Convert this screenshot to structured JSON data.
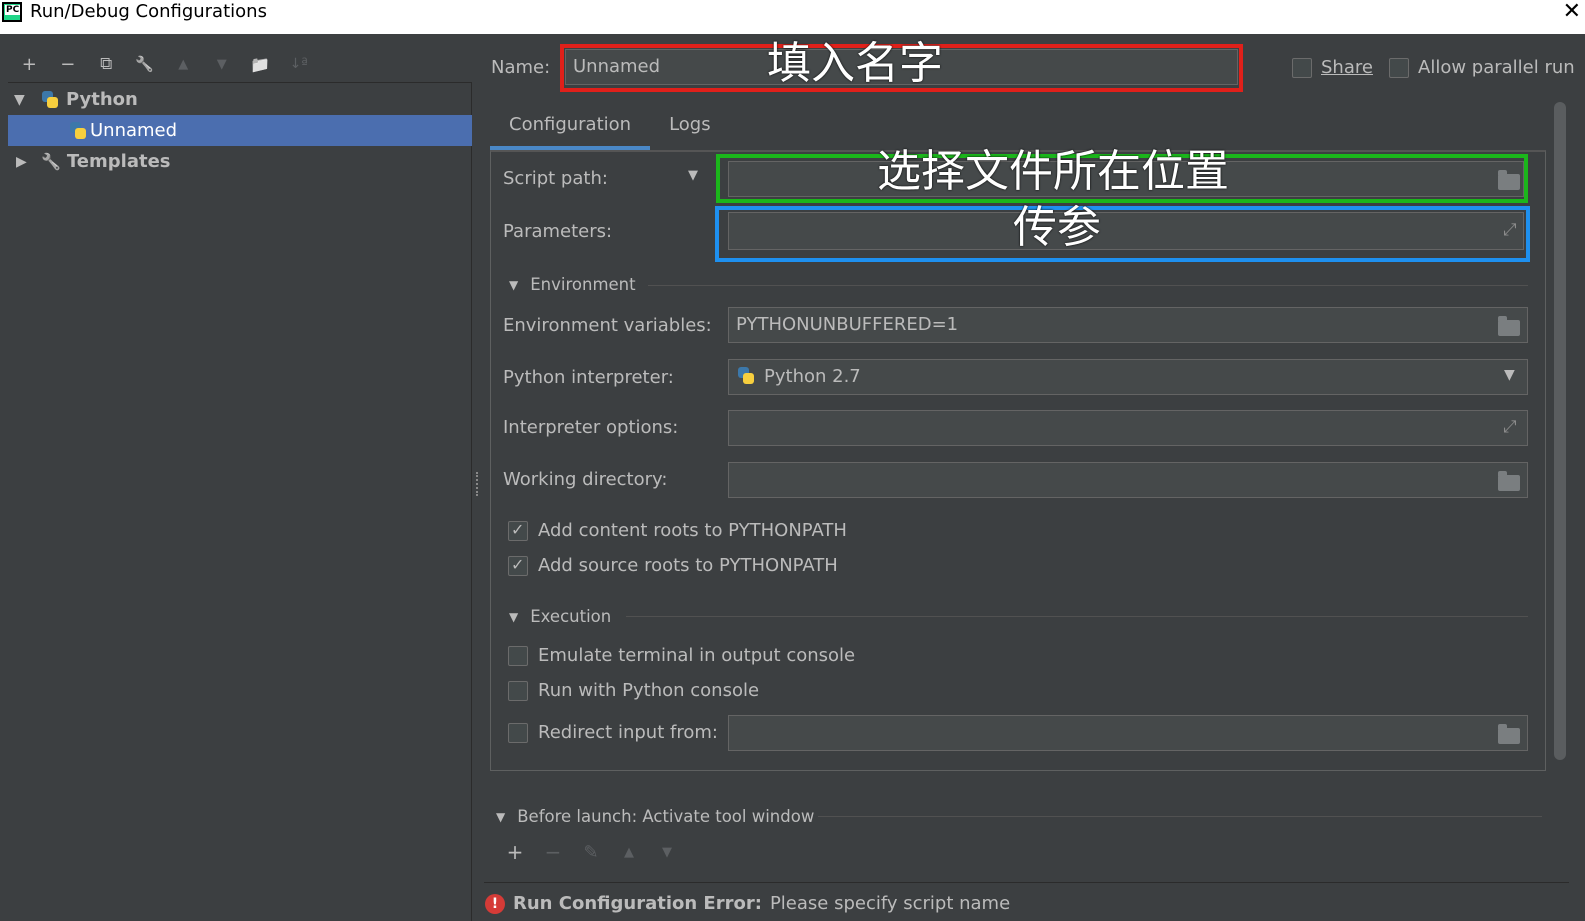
{
  "window": {
    "title": "Run/Debug Configurations",
    "close_glyph": "✕"
  },
  "left_toolbar": [
    {
      "name": "add-icon",
      "glyph": "+",
      "enabled": true
    },
    {
      "name": "remove-icon",
      "glyph": "−",
      "enabled": true
    },
    {
      "name": "copy-icon",
      "glyph": "⧉",
      "enabled": true
    },
    {
      "name": "wrench-icon",
      "glyph": "🔧",
      "enabled": true
    },
    {
      "name": "move-up-icon",
      "glyph": "▲",
      "enabled": false
    },
    {
      "name": "move-down-icon",
      "glyph": "▼",
      "enabled": false
    },
    {
      "name": "folder-add-icon",
      "glyph": "📁",
      "enabled": true
    },
    {
      "name": "sort-icon",
      "glyph": "↓ª",
      "enabled": false
    }
  ],
  "tree": {
    "python_label": "Python",
    "unnamed_label": "Unnamed",
    "templates_label": "Templates"
  },
  "name_field": {
    "label": "Name:",
    "value": "Unnamed"
  },
  "options": {
    "share_label": "Share",
    "share_checked": false,
    "parallel_label": "Allow parallel run",
    "parallel_checked": false
  },
  "tabs": [
    {
      "label": "Configuration",
      "active": true
    },
    {
      "label": "Logs",
      "active": false
    }
  ],
  "annotations": {
    "name": "填入名字",
    "script": "选择文件所在位置",
    "params": "传参",
    "colors": {
      "red": "#e0201a",
      "green": "#1bb61b",
      "blue": "#1e90ef"
    }
  },
  "config": {
    "script_path_label": "Script path:",
    "script_path_value": "",
    "parameters_label": "Parameters:",
    "parameters_value": "",
    "environment_section": "Environment",
    "env_vars_label": "Environment variables:",
    "env_vars_value": "PYTHONUNBUFFERED=1",
    "interpreter_label": "Python interpreter:",
    "interpreter_value": "Python 2.7",
    "interp_options_label": "Interpreter options:",
    "interp_options_value": "",
    "working_dir_label": "Working directory:",
    "working_dir_value": "",
    "content_roots_label": "Add content roots to PYTHONPATH",
    "content_roots_checked": true,
    "source_roots_label": "Add source roots to PYTHONPATH",
    "source_roots_checked": true,
    "execution_section": "Execution",
    "emulate_terminal_label": "Emulate terminal in output console",
    "emulate_terminal_checked": false,
    "python_console_label": "Run with Python console",
    "python_console_checked": false,
    "redirect_label": "Redirect input from:",
    "redirect_checked": false,
    "redirect_value": ""
  },
  "before_launch": {
    "label": "Before launch: Activate tool window"
  },
  "error": {
    "prefix": "Run Configuration Error:",
    "message": "Please specify script name"
  }
}
